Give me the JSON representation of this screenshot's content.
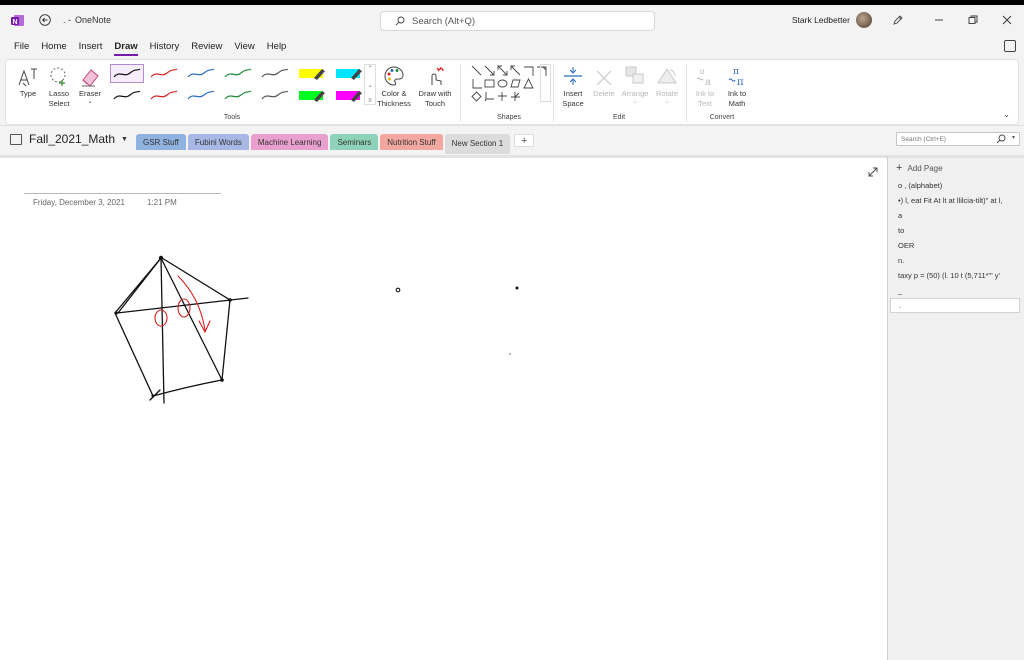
{
  "titlebar": {
    "doc_title": ". -",
    "app_name": "OneNote",
    "search_placeholder": "Search (Alt+Q)",
    "user_name": "Stark Ledbetter"
  },
  "menu": {
    "items": [
      "File",
      "Home",
      "Insert",
      "Draw",
      "History",
      "Review",
      "View",
      "Help"
    ],
    "active": "Draw"
  },
  "ribbon": {
    "tools": {
      "type_label": "Type",
      "lasso_label": "Lasso\nSelect",
      "eraser_label": "Eraser",
      "color_label": "Color &\nThickness",
      "draw_touch_label": "Draw with\nTouch",
      "group_label": "Tools"
    },
    "pens_row1": [
      "#111111",
      "#d62020",
      "#2b6cc2",
      "#1e8a3a",
      "#555555",
      "#ffff00",
      "#00e5ff"
    ],
    "pens_row2": [
      "#111111",
      "#d62020",
      "#2b6cc2",
      "#1e8a3a",
      "#555555",
      "#00ff20",
      "#ff00ff"
    ],
    "shapes_label": "Shapes",
    "edit": {
      "insert_space": "Insert\nSpace",
      "delete": "Delete",
      "arrange": "Arrange",
      "rotate": "Rotate",
      "group_label": "Edit"
    },
    "convert": {
      "ink_to_text": "Ink to\nText",
      "ink_to_math": "Ink to\nMath",
      "group_label": "Convert"
    }
  },
  "sections": {
    "notebook_name": "Fall_2021_Math",
    "tabs": [
      {
        "label": "GSR Stuff",
        "color": "#8fb2e0"
      },
      {
        "label": "Fubini Words",
        "color": "#a7b8e6"
      },
      {
        "label": "Machine Learning",
        "color": "#eaa0cf"
      },
      {
        "label": "Seminars",
        "color": "#8ed2b9"
      },
      {
        "label": "Nutrition Stuff",
        "color": "#f2a7a0"
      },
      {
        "label": "New Section 1",
        "color": "#dcdcdc"
      }
    ],
    "add_label": "+",
    "page_search_placeholder": "Search (Ctrl+E)"
  },
  "page": {
    "date": "Friday, December 3, 2021",
    "time": "1:21 PM"
  },
  "page_pane": {
    "add_page": "Add Page",
    "pages": [
      "o , (alphabet)",
      "•) l, eat Fit At lt at llilcia-tilt)\" at l,",
      "a",
      "to",
      "OER",
      "n.",
      "taxy p = (50) (l. 10 t (5,711*'\" y'",
      "_",
      "."
    ]
  }
}
